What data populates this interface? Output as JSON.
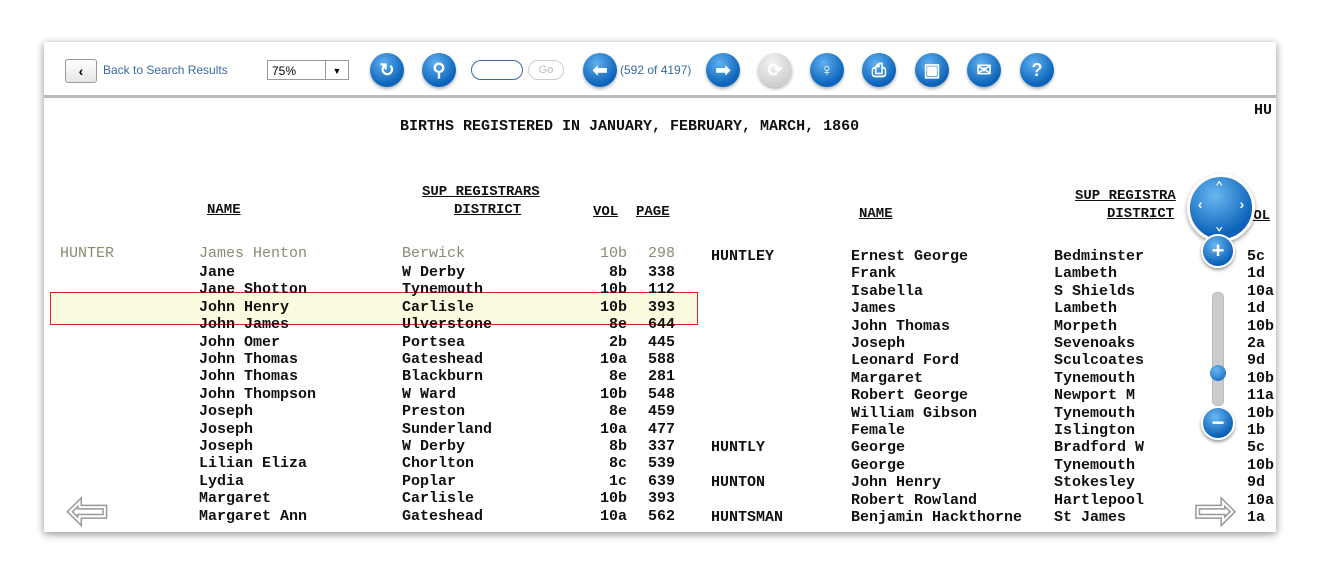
{
  "toolbar": {
    "back_label": "Back to Search Results",
    "zoom_value": "75%",
    "go_label": "Go",
    "page_counter": "(592 of 4197)",
    "icons": [
      "rotate-icon",
      "search-icon",
      "previous-icon",
      "next-icon",
      "refresh-icon",
      "lightbulb-icon",
      "print-icon",
      "save-icon",
      "email-icon",
      "help-icon"
    ]
  },
  "document": {
    "title": "BIRTHS REGISTERED IN JANUARY, FEBRUARY, MARCH, 1860",
    "corner_text": "HU",
    "headers": {
      "name": "NAME",
      "district_1": "SUP REGISTRARS",
      "district_2": "DISTRICT",
      "vol": "VOL",
      "page": "PAGE",
      "right_district_1": "SUP REGISTRA",
      "right_district_2": "DISTRICT",
      "right_vol": "VOL"
    },
    "left_rows": [
      {
        "surname": "HUNTER",
        "name": "James Henton",
        "district": "Berwick",
        "vol": "10b",
        "page": "298"
      },
      {
        "surname": "",
        "name": "Jane",
        "district": "W Derby",
        "vol": "8b",
        "page": "338"
      },
      {
        "surname": "",
        "name": "Jane Shotton",
        "district": "Tynemouth",
        "vol": "10b",
        "page": "112"
      },
      {
        "surname": "",
        "name": "John Henry",
        "district": "Carlisle",
        "vol": "10b",
        "page": "393"
      },
      {
        "surname": "",
        "name": "John James",
        "district": "Ulverstone",
        "vol": "8e",
        "page": "644"
      },
      {
        "surname": "",
        "name": "John Omer",
        "district": "Portsea",
        "vol": "2b",
        "page": "445"
      },
      {
        "surname": "",
        "name": "John Thomas",
        "district": "Gateshead",
        "vol": "10a",
        "page": "588"
      },
      {
        "surname": "",
        "name": "John Thomas",
        "district": "Blackburn",
        "vol": "8e",
        "page": "281"
      },
      {
        "surname": "",
        "name": "John Thompson",
        "district": "W Ward",
        "vol": "10b",
        "page": "548"
      },
      {
        "surname": "",
        "name": "Joseph",
        "district": "Preston",
        "vol": "8e",
        "page": "459"
      },
      {
        "surname": "",
        "name": "Joseph",
        "district": "Sunderland",
        "vol": "10a",
        "page": "477"
      },
      {
        "surname": "",
        "name": "Joseph",
        "district": "W Derby",
        "vol": "8b",
        "page": "337"
      },
      {
        "surname": "",
        "name": "Lilian Eliza",
        "district": "Chorlton",
        "vol": "8c",
        "page": "539"
      },
      {
        "surname": "",
        "name": "Lydia",
        "district": "Poplar",
        "vol": "1c",
        "page": "639"
      },
      {
        "surname": "",
        "name": "Margaret",
        "district": "Carlisle",
        "vol": "10b",
        "page": "393"
      },
      {
        "surname": "",
        "name": "Margaret Ann",
        "district": "Gateshead",
        "vol": "10a",
        "page": "562"
      }
    ],
    "right_rows": [
      {
        "surname": "HUNTLEY",
        "name": "Ernest George",
        "district": "Bedminster",
        "vol": "5c"
      },
      {
        "surname": "",
        "name": "Frank",
        "district": "Lambeth",
        "vol": "1d"
      },
      {
        "surname": "",
        "name": "Isabella",
        "district": "S Shields",
        "vol": "10a"
      },
      {
        "surname": "",
        "name": "James",
        "district": "Lambeth",
        "vol": "1d"
      },
      {
        "surname": "",
        "name": "John Thomas",
        "district": "Morpeth",
        "vol": "10b"
      },
      {
        "surname": "",
        "name": "Joseph",
        "district": "Sevenoaks",
        "vol": "2a"
      },
      {
        "surname": "",
        "name": "Leonard Ford",
        "district": "Sculcoates",
        "vol": "9d"
      },
      {
        "surname": "",
        "name": "Margaret",
        "district": "Tynemouth",
        "vol": "10b"
      },
      {
        "surname": "",
        "name": "Robert George",
        "district": "Newport M",
        "vol": "11a"
      },
      {
        "surname": "",
        "name": "William Gibson",
        "district": "Tynemouth",
        "vol": "10b"
      },
      {
        "surname": "",
        "name": "Female",
        "district": "Islington",
        "vol": "1b"
      },
      {
        "surname": "HUNTLY",
        "name": "George",
        "district": "Bradford W",
        "vol": "5c"
      },
      {
        "surname": "",
        "name": "George",
        "district": "Tynemouth",
        "vol": "10b"
      },
      {
        "surname": "HUNTON",
        "name": "John Henry",
        "district": "Stokesley",
        "vol": "9d"
      },
      {
        "surname": "",
        "name": "Robert Rowland",
        "district": "Hartlepool",
        "vol": "10a"
      },
      {
        "surname": "HUNTSMAN",
        "name": "Benjamin Hackthorne",
        "district": "St James",
        "vol": "1a"
      }
    ]
  },
  "colors": {
    "accent": "#0b62b8",
    "highlight_border": "#e02020"
  }
}
